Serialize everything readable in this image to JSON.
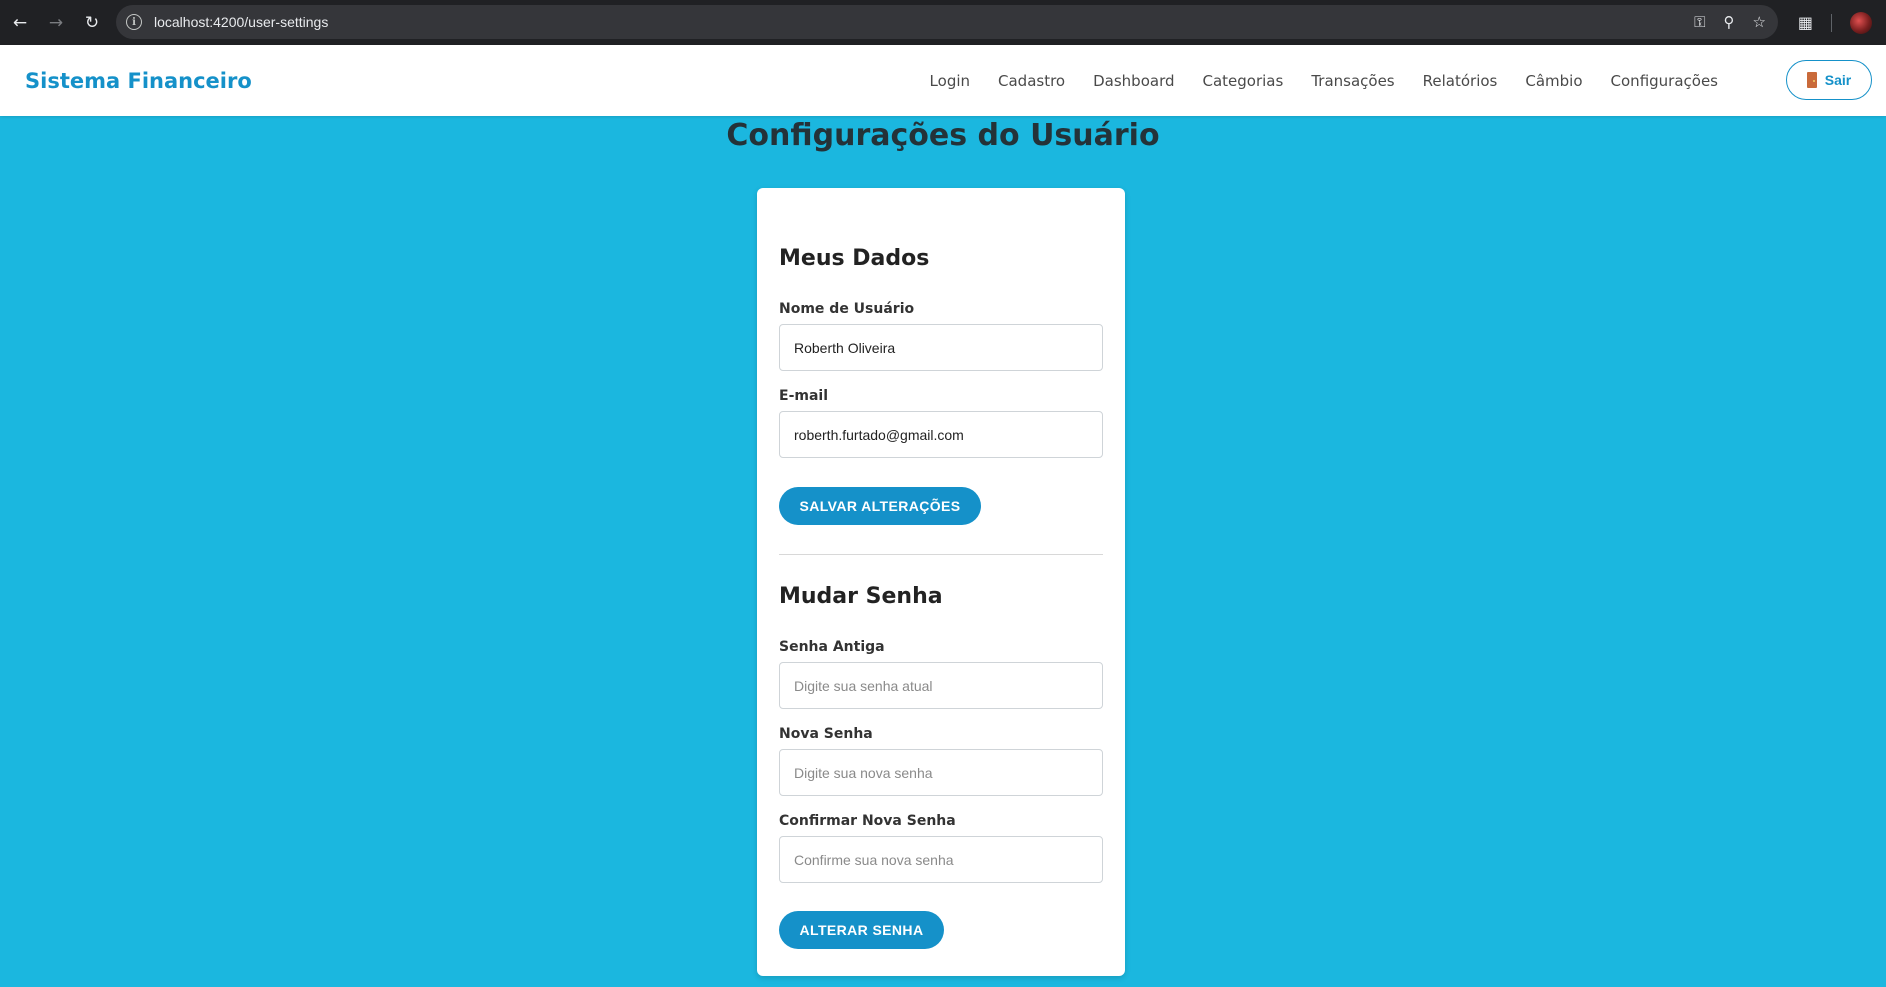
{
  "browser": {
    "url": "localhost:4200/user-settings"
  },
  "header": {
    "brand": "Sistema Financeiro",
    "nav": [
      "Login",
      "Cadastro",
      "Dashboard",
      "Categorias",
      "Transações",
      "Relatórios",
      "Câmbio",
      "Configurações"
    ],
    "logout_label": "Sair"
  },
  "page": {
    "title": "Configurações do Usuário"
  },
  "profile": {
    "section_title": "Meus Dados",
    "username_label": "Nome de Usuário",
    "username_value": "Roberth Oliveira",
    "email_label": "E-mail",
    "email_value": "roberth.furtado@gmail.com",
    "save_label": "SALVAR ALTERAÇÕES"
  },
  "password": {
    "section_title": "Mudar Senha",
    "old_label": "Senha Antiga",
    "old_placeholder": "Digite sua senha atual",
    "new_label": "Nova Senha",
    "new_placeholder": "Digite sua nova senha",
    "confirm_label": "Confirmar Nova Senha",
    "confirm_placeholder": "Confirme sua nova senha",
    "submit_label": "ALTERAR SENHA"
  },
  "colors": {
    "background": "#1bb7df",
    "accent": "#1591c9"
  }
}
